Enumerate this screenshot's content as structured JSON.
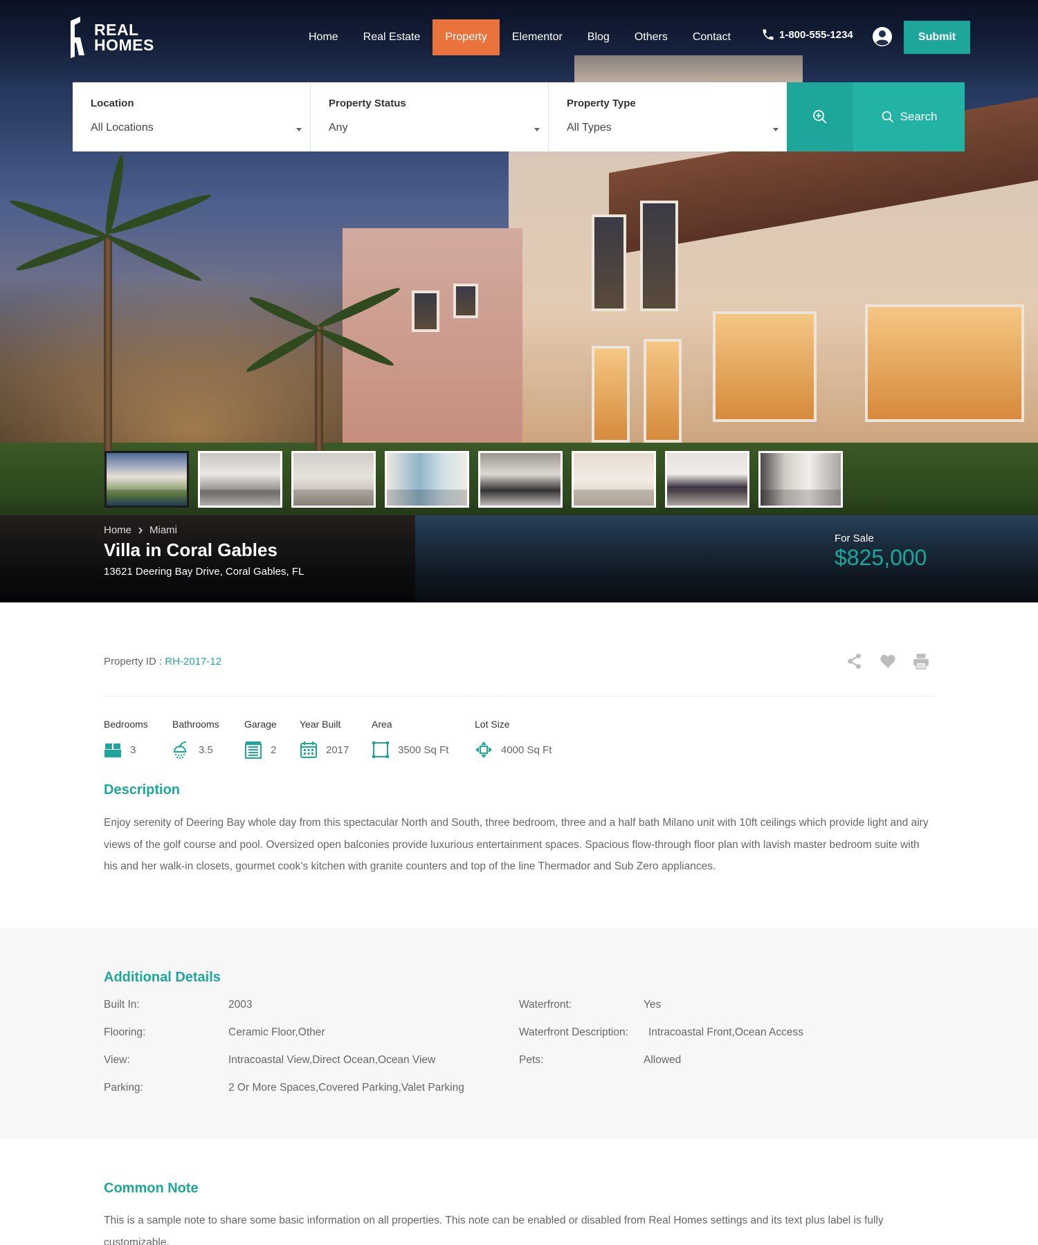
{
  "brand": {
    "line1": "REAL",
    "line2": "HOMES"
  },
  "nav": {
    "items": [
      "Home",
      "Real Estate",
      "Property",
      "Elementor",
      "Blog",
      "Others",
      "Contact"
    ],
    "active": "Property"
  },
  "header": {
    "phone": "1-800-555-1234",
    "submit_label": "Submit"
  },
  "search": {
    "location": {
      "label": "Location",
      "value": "All Locations"
    },
    "status": {
      "label": "Property Status",
      "value": "Any"
    },
    "type": {
      "label": "Property Type",
      "value": "All Types"
    },
    "button_label": "Search"
  },
  "gallery": {
    "count": 8,
    "active_index": 0
  },
  "breadcrumb": [
    "Home",
    "Miami"
  ],
  "property": {
    "title": "Villa in Coral Gables",
    "address": "13621 Deering Bay Drive, Coral Gables, FL",
    "status": "For Sale",
    "price": "$825,000",
    "id_label": "Property ID :",
    "id_value": "RH-2017-12"
  },
  "features": [
    {
      "label": "Bedrooms",
      "value": "3",
      "icon": "bed-icon"
    },
    {
      "label": "Bathrooms",
      "value": "3.5",
      "icon": "shower-icon"
    },
    {
      "label": "Garage",
      "value": "2",
      "icon": "garage-icon"
    },
    {
      "label": "Year Built",
      "value": "2017",
      "icon": "calendar-icon"
    },
    {
      "label": "Area",
      "value": "3500 Sq Ft",
      "icon": "area-icon"
    },
    {
      "label": "Lot Size",
      "value": "4000 Sq Ft",
      "icon": "lot-size-icon"
    }
  ],
  "description": {
    "heading": "Description",
    "text": "Enjoy serenity of Deering Bay whole day from this spectacular North and South, three bedroom, three and a half bath Milano unit with 10ft ceilings which provide light and airy views of the golf course and pool. Oversized open balconies provide luxurious entertainment spaces. Spacious flow-through floor plan with lavish master bedroom suite with his and her walk-in closets, gourmet cook’s kitchen with granite counters and top of the line Thermador and Sub Zero appliances."
  },
  "additional": {
    "heading": "Additional Details",
    "left": [
      {
        "key": "Built In:",
        "value": "2003"
      },
      {
        "key": "Flooring:",
        "value": "Ceramic Floor,Other"
      },
      {
        "key": "View:",
        "value": "Intracoastal View,Direct Ocean,Ocean View"
      },
      {
        "key": "Parking:",
        "value": "2 Or More Spaces,Covered Parking,Valet Parking"
      }
    ],
    "right": [
      {
        "key": "Waterfront:",
        "value": "Yes"
      },
      {
        "key": "Waterfront Description:",
        "value": "Intracoastal Front,Ocean Access"
      },
      {
        "key": "Pets:",
        "value": "Allowed"
      }
    ]
  },
  "note": {
    "heading": "Common Note",
    "text": "This is a sample note to share some basic information on all properties. This note can be enabled or disabled from Real Homes settings and its text plus label is fully customizable."
  },
  "colors": {
    "accent": "#1ea69a",
    "nav_active": "#ea723d"
  }
}
